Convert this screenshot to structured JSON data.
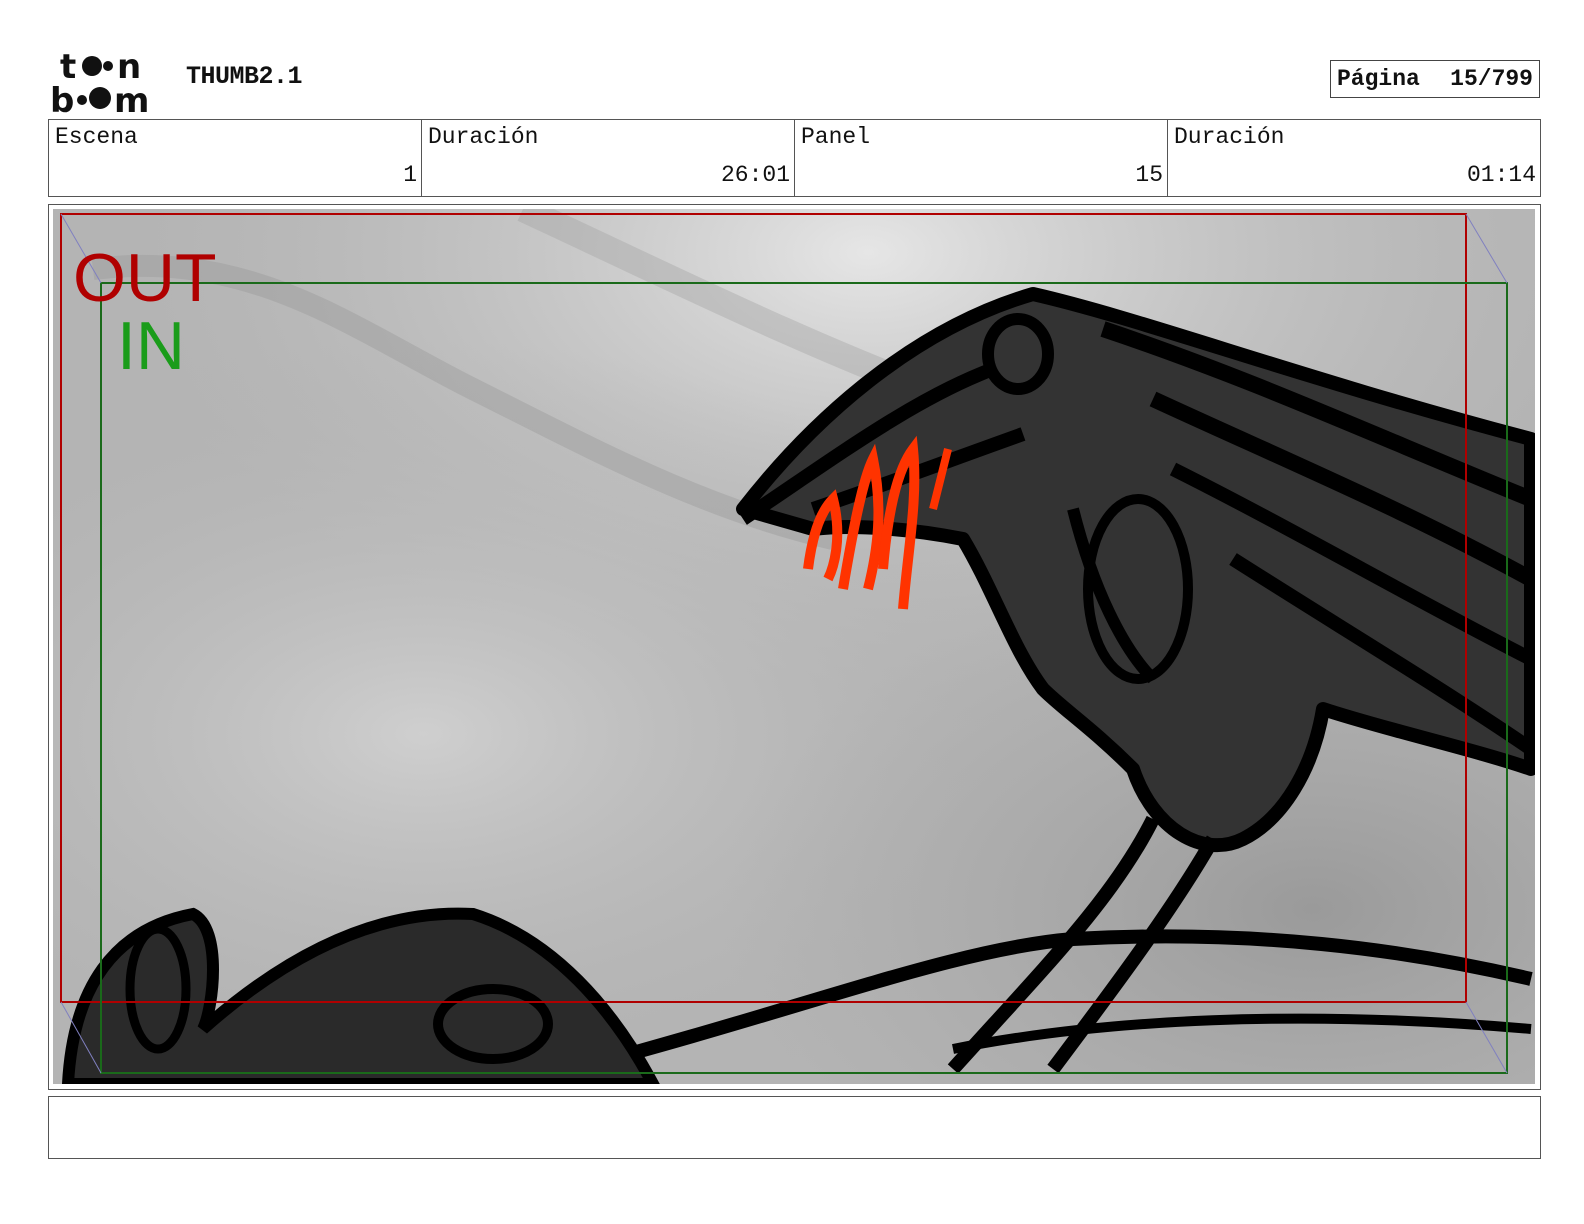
{
  "header": {
    "logo_text": "toon boom",
    "title": "THUMB2.1",
    "page_label": "Página",
    "page_value": "15/799"
  },
  "info": {
    "scene_label": "Escena",
    "scene_value": "1",
    "scene_duration_label": "Duración",
    "scene_duration_value": "26:01",
    "panel_label": "Panel",
    "panel_value": "15",
    "panel_duration_label": "Duración",
    "panel_duration_value": "01:14"
  },
  "frame_guides": {
    "out_label": "OUT",
    "in_label": "IN",
    "out_color": "#b00000",
    "in_color": "#1a8c1a"
  },
  "panel_drawing": {
    "subject": "crow-sketch",
    "accent_color": "#ff3300"
  },
  "notes": {
    "text": ""
  }
}
